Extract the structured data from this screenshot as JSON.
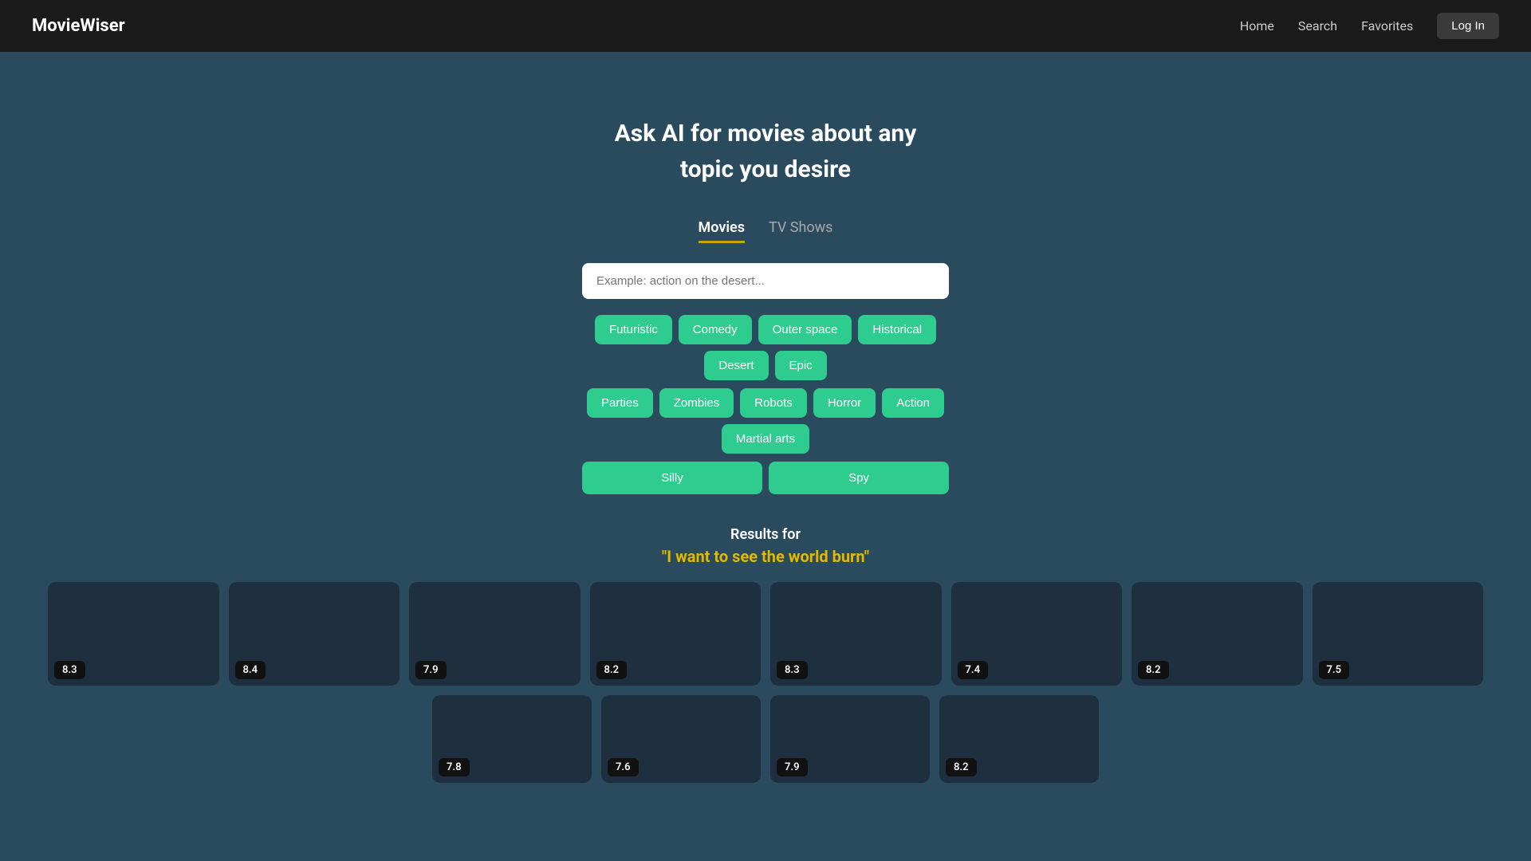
{
  "app": {
    "name": "MovieWiser"
  },
  "nav": {
    "logo": "MovieWiser",
    "links": [
      {
        "label": "Home",
        "name": "home-link"
      },
      {
        "label": "Search",
        "name": "search-link"
      },
      {
        "label": "Favorites",
        "name": "favorites-link"
      }
    ],
    "login_label": "Log In"
  },
  "hero": {
    "title_line1": "Ask AI for movies about any",
    "title_line2": "topic you desire"
  },
  "tabs": [
    {
      "label": "Movies",
      "active": true
    },
    {
      "label": "TV Shows",
      "active": false
    }
  ],
  "search": {
    "placeholder": "Example: action on the desert..."
  },
  "tags": {
    "row1": [
      "Futuristic",
      "Comedy",
      "Outer space",
      "Historical",
      "Desert",
      "Epic"
    ],
    "row2": [
      "Parties",
      "Zombies",
      "Robots",
      "Horror",
      "Action",
      "Martial arts"
    ],
    "row3": [
      "Silly",
      "Spy"
    ]
  },
  "results": {
    "label": "Results for",
    "query": "\"I want to see the world burn\"",
    "row1_ratings": [
      "8.3",
      "8.4",
      "7.9",
      "8.2",
      "8.3",
      "7.4",
      "8.2",
      "7.5"
    ],
    "row2_ratings": [
      "7.8",
      "7.6",
      "7.9",
      "8.2"
    ]
  }
}
